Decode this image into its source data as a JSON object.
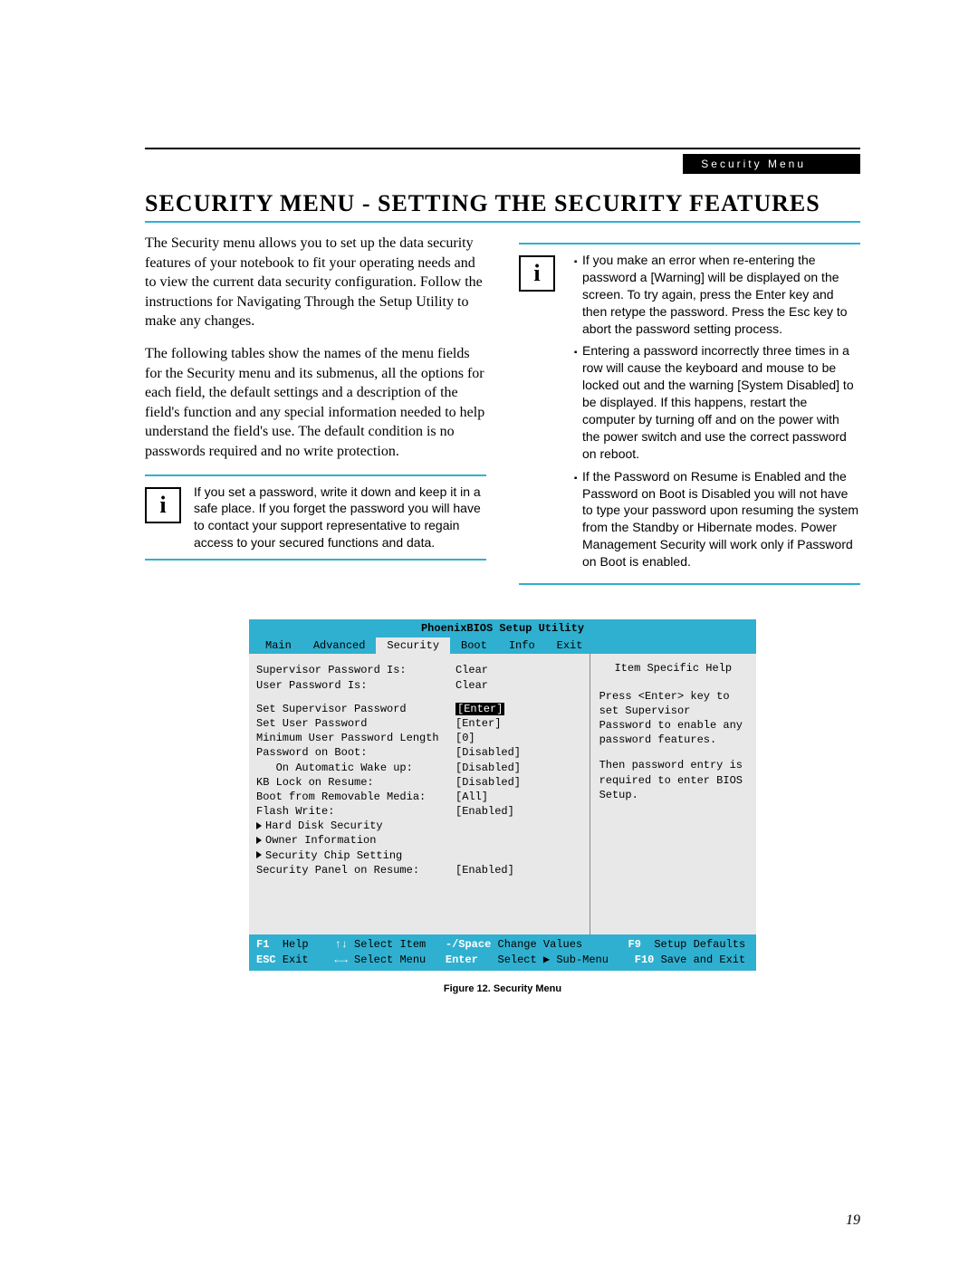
{
  "header": {
    "tab": "Security Menu"
  },
  "title": "SECURITY MENU - SETTING THE SECURITY FEATURES",
  "body": {
    "p1": "The Security menu allows you to set up the data security features of your notebook to fit your operating needs and to view the current data security configuration. Follow the instructions for Navigating Through the Setup Utility to make any changes.",
    "p2": "The following tables show the names of the menu fields for the Security menu and its submenus, all the options for each field, the default settings and a description of the field's function and any special information needed to help understand the field's use. The default condition is no passwords required and no write protection."
  },
  "callout_left": "If you set a password, write it down and keep it in a safe place. If you forget the password you will have to contact your support representative to regain access to your secured functions and data.",
  "callout_right": {
    "b1": "If you make an error when re-entering the password a [Warning] will be displayed on the screen. To try again, press the Enter key and then retype the password. Press the Esc key to abort the password setting process.",
    "b2": "Entering a password incorrectly three times in a row will cause the keyboard and mouse to be locked out and the warning [System Disabled] to be displayed. If this happens, restart the computer by turning off and on the power with the power switch and use the correct password on reboot.",
    "b3": "If the Password on Resume is Enabled and the Password on Boot is Disabled you will not have to type your password upon resuming the system from the Standby or Hibernate modes. Power Management Security will work only if Password on Boot is enabled."
  },
  "bios": {
    "title": "PhoenixBIOS Setup Utility",
    "tabs": [
      "Main",
      "Advanced",
      "Security",
      "Boot",
      "Info",
      "Exit"
    ],
    "active_tab": "Security",
    "help": {
      "title": "Item Specific Help",
      "text1": "Press <Enter> key to set Supervisor Password to enable any password features.",
      "text2": "Then password entry is required to enter BIOS Setup."
    },
    "rows": [
      {
        "label": "Supervisor Password Is:",
        "value": "Clear",
        "indent": 0
      },
      {
        "label": "User Password Is:",
        "value": "Clear",
        "indent": 0
      },
      {
        "spacer": true
      },
      {
        "label": "Set Supervisor Password",
        "value": "[Enter]",
        "indent": 0,
        "highlight": true
      },
      {
        "label": "Set User Password",
        "value": "[Enter]",
        "indent": 0
      },
      {
        "label": "Minimum User Password Length",
        "value": "[0]",
        "indent": 0
      },
      {
        "label": "Password on Boot:",
        "value": "[Disabled]",
        "indent": 0
      },
      {
        "label": "On Automatic Wake up:",
        "value": "[Disabled]",
        "indent": 1
      },
      {
        "label": "KB Lock on Resume:",
        "value": "[Disabled]",
        "indent": 0
      },
      {
        "label": "Boot from Removable Media:",
        "value": "[All]",
        "indent": 0
      },
      {
        "label": "Flash Write:",
        "value": "[Enabled]",
        "indent": 0
      },
      {
        "label": "Hard Disk Security",
        "value": "",
        "indent": 0,
        "submenu": true
      },
      {
        "label": "Owner Information",
        "value": "",
        "indent": 0,
        "submenu": true
      },
      {
        "label": "Security Chip Setting",
        "value": "",
        "indent": 0,
        "submenu": true
      },
      {
        "label": "Security Panel on Resume:",
        "value": "[Enabled]",
        "indent": 0
      }
    ],
    "footer": {
      "r1": {
        "k1": "F1",
        "t1": "Help",
        "k2": "↑↓",
        "t2": "Select Item",
        "k3": "-/Space",
        "t3": "Change Values",
        "k4": "F9",
        "t4": "Setup Defaults"
      },
      "r2": {
        "k1": "ESC",
        "t1": "Exit",
        "k2": "←→",
        "t2": "Select Menu",
        "k3": "Enter",
        "t3": "Select ▶ Sub-Menu",
        "k4": "F10",
        "t4": "Save and Exit"
      }
    }
  },
  "figure_caption": "Figure 12.  Security Menu",
  "page_number": "19"
}
